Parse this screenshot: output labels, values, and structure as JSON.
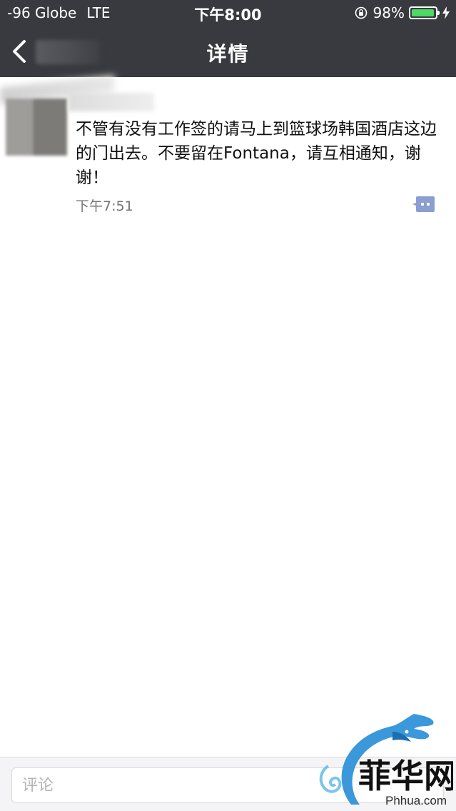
{
  "status_bar": {
    "carrier": "-96 Globe",
    "network": "LTE",
    "time": "下午8:00",
    "battery_percent": "98%",
    "battery_level": 0.98,
    "icons": [
      "orientation-lock-icon",
      "battery-icon",
      "charging-bolt-icon"
    ]
  },
  "nav": {
    "title": "详情",
    "back_icon": "chevron-left-icon"
  },
  "post": {
    "text": "不管有没有工作签的请马上到篮球场韩国酒店这边的门出去。不要留在Fontana，请互相通知，谢谢！",
    "time": "下午7:51",
    "comment_icon": "comment-bubble-icon"
  },
  "comment_bar": {
    "placeholder": "评论"
  },
  "watermark": {
    "logo": "dragon-logo",
    "text": "Phhua.com"
  },
  "colors": {
    "bar_background": "#393a3f",
    "comment_icon": "#8a9ed0",
    "battery_fill": "#4cd964",
    "watermark_blue": "#2a8fd8"
  }
}
